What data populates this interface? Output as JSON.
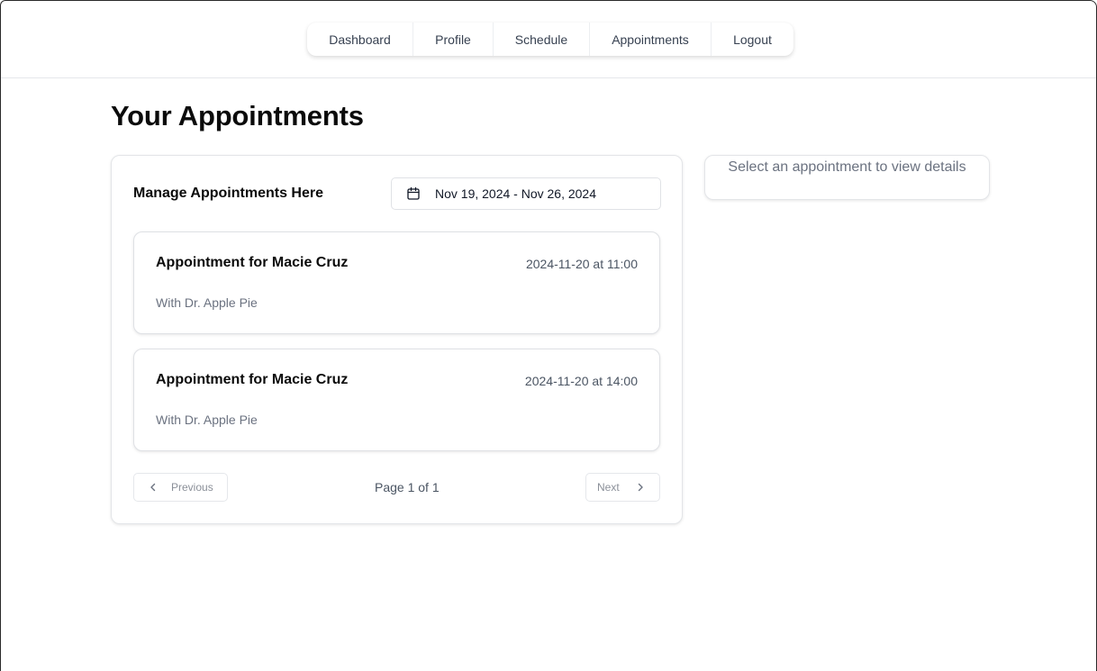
{
  "nav": {
    "items": [
      {
        "label": "Dashboard"
      },
      {
        "label": "Profile"
      },
      {
        "label": "Schedule"
      },
      {
        "label": "Appointments"
      },
      {
        "label": "Logout"
      }
    ]
  },
  "page": {
    "title": "Your Appointments"
  },
  "appointments_panel": {
    "heading": "Manage Appointments Here",
    "date_range": {
      "icon": "calendar-icon",
      "value": "Nov 19, 2024 - Nov 26, 2024"
    },
    "appointments": [
      {
        "title": "Appointment for Macie Cruz",
        "datetime": "2024-11-20 at 11:00",
        "doctor": "With Dr. Apple Pie"
      },
      {
        "title": "Appointment for Macie Cruz",
        "datetime": "2024-11-20 at 14:00",
        "doctor": "With Dr. Apple Pie"
      }
    ],
    "pagination": {
      "previous_label": "Previous",
      "next_label": "Next",
      "page_indicator": "Page 1 of 1",
      "previous_icon": "chevron-left-icon",
      "next_icon": "chevron-right-icon"
    }
  },
  "details_panel": {
    "placeholder": "Select an appointment to view details"
  },
  "colors": {
    "border": "#e3e5e8",
    "muted_text": "#6b7280",
    "heading_text": "#0b0b0b"
  }
}
